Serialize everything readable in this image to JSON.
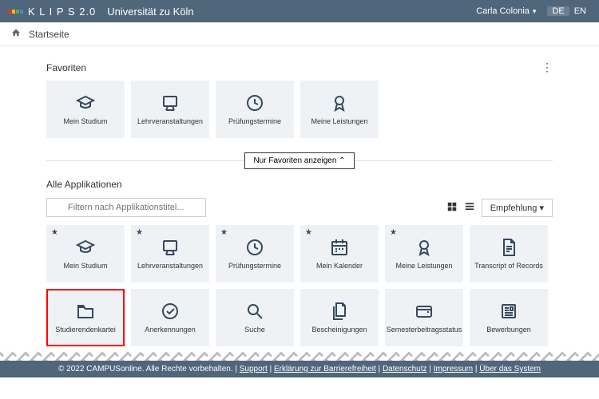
{
  "header": {
    "brand": "K L I P S 2.0",
    "university": "Universität zu Köln",
    "user": "Carla Colonia",
    "lang_de": "DE",
    "lang_en": "EN"
  },
  "breadcrumb": "Startseite",
  "favorites": {
    "title": "Favoriten",
    "items": [
      {
        "label": "Mein Studium",
        "icon": "cap"
      },
      {
        "label": "Lehrveranstaltungen",
        "icon": "board"
      },
      {
        "label": "Prüfungstermine",
        "icon": "clock"
      },
      {
        "label": "Meine Leistungen",
        "icon": "rosette"
      }
    ]
  },
  "toggle": "Nur Favoriten anzeigen",
  "apps": {
    "title": "Alle Applikationen",
    "filter_placeholder": "Filtern nach Applikationstitel...",
    "sort_label": "Empfehlung",
    "items": [
      {
        "label": "Mein Studium",
        "icon": "cap",
        "fav": true
      },
      {
        "label": "Lehrveranstaltungen",
        "icon": "board",
        "fav": true
      },
      {
        "label": "Prüfungstermine",
        "icon": "clock",
        "fav": true
      },
      {
        "label": "Mein Kalender",
        "icon": "calendar",
        "fav": true
      },
      {
        "label": "Meine Leistungen",
        "icon": "rosette",
        "fav": true
      },
      {
        "label": "Transcript of Records",
        "icon": "doc"
      },
      {
        "label": "Studierendenkartei",
        "icon": "folder",
        "highlight": true
      },
      {
        "label": "Anerkennungen",
        "icon": "check"
      },
      {
        "label": "Suche",
        "icon": "search"
      },
      {
        "label": "Bescheinigungen",
        "icon": "docs"
      },
      {
        "label": "Semesterbeitragsstatus",
        "icon": "wallet"
      },
      {
        "label": "Bewerbungen",
        "icon": "news"
      }
    ]
  },
  "footer": {
    "copyright": "© 2022 CAMPUSonline. Alle Rechte vorbehalten.",
    "links": [
      "Support",
      "Erklärung zur Barrierefreiheit",
      "Datenschutz",
      "Impressum",
      "Über das System"
    ]
  }
}
